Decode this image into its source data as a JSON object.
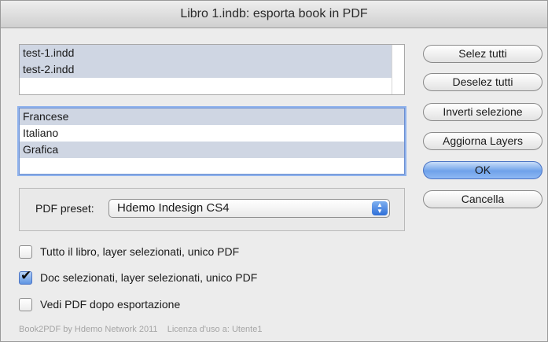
{
  "window": {
    "title": "Libro 1.indb: esporta book in PDF"
  },
  "documents_list": {
    "items": [
      {
        "label": "test-1.indd",
        "selected": true
      },
      {
        "label": "test-2.indd",
        "selected": true
      }
    ]
  },
  "layers_list": {
    "items": [
      {
        "label": "Francese",
        "selected": true
      },
      {
        "label": "Italiano",
        "selected": false
      },
      {
        "label": "Grafica",
        "selected": true
      }
    ]
  },
  "pdf_preset": {
    "label": "PDF preset:",
    "value": "Hdemo Indesign CS4"
  },
  "buttons": {
    "select_all": "Selez tutti",
    "deselect_all": "Deselez tutti",
    "invert_selection": "Inverti selezione",
    "refresh_layers": "Aggiorna Layers",
    "ok": "OK",
    "cancel": "Cancella"
  },
  "options": [
    {
      "label": "Tutto il libro, layer selezionati, unico PDF",
      "checked": false
    },
    {
      "label": "Doc selezionati, layer selezionati, unico PDF",
      "checked": true
    },
    {
      "label": "Vedi PDF dopo esportazione",
      "checked": false
    }
  ],
  "footer": {
    "credit": "Book2PDF by Hdemo Network 2011",
    "license": "Licenza d'uso a: Utente1"
  },
  "colors": {
    "selection": "#cfd6e3",
    "focus_ring": "#8fb2ec",
    "default_button": "#6fa2ea"
  }
}
